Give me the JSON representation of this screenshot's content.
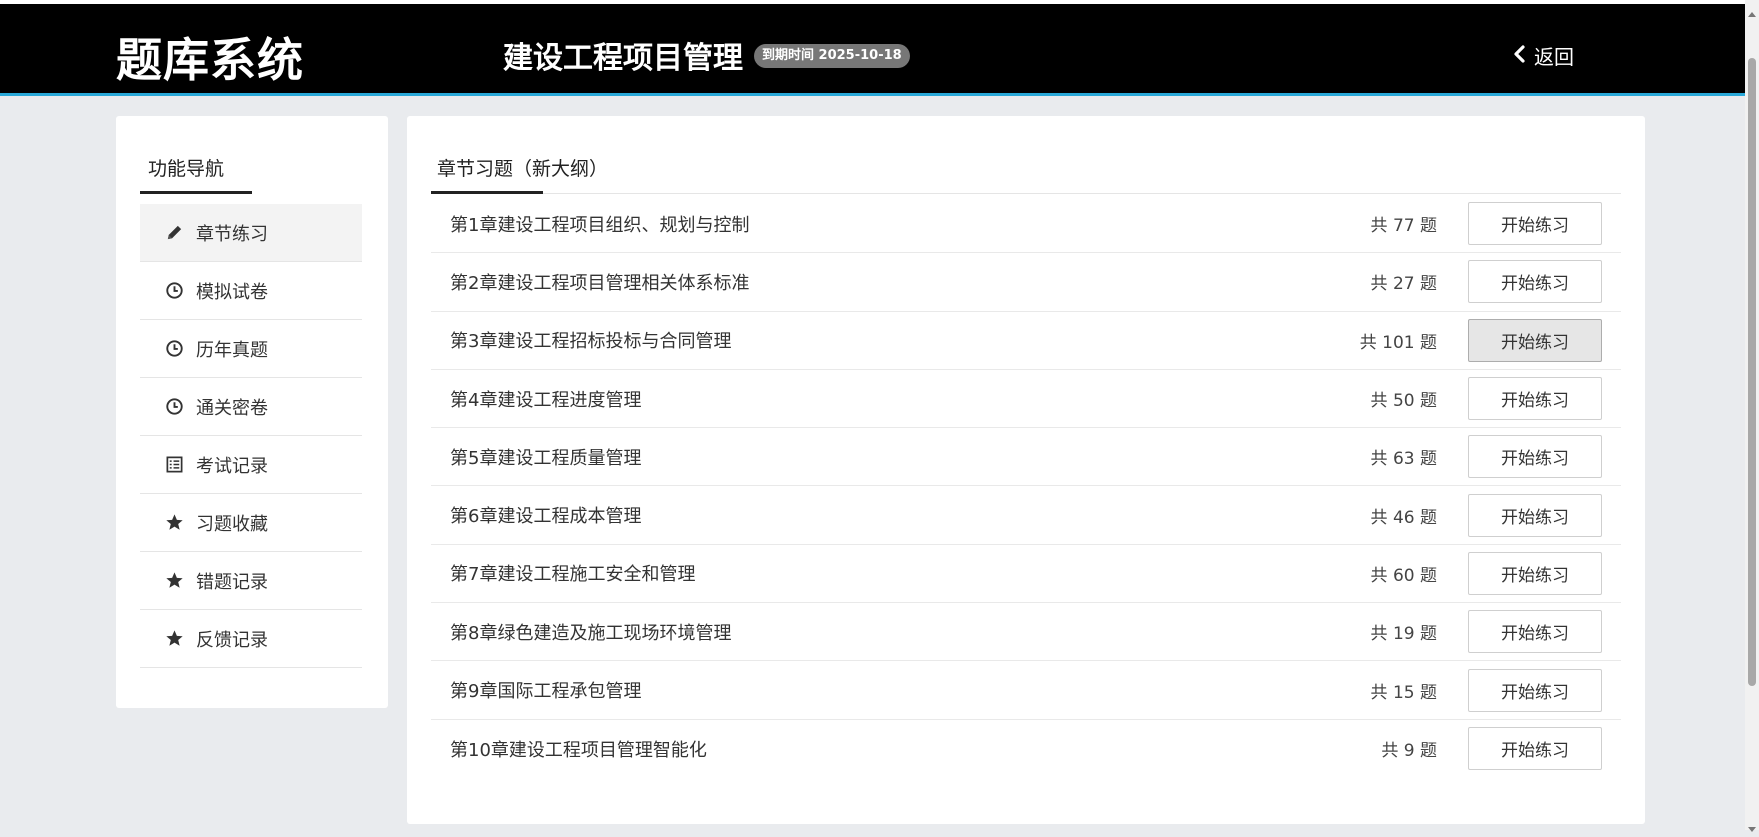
{
  "header": {
    "logo": "题库系统",
    "subject": "建设工程项目管理",
    "expire_badge": "到期时间 2025-10-18",
    "back_label": "返回"
  },
  "sidebar": {
    "title": "功能导航",
    "items": [
      {
        "label": "章节练习",
        "icon": "pencil-icon",
        "active": true
      },
      {
        "label": "模拟试卷",
        "icon": "clock-icon"
      },
      {
        "label": "历年真题",
        "icon": "clock-icon"
      },
      {
        "label": "通关密卷",
        "icon": "clock-icon"
      },
      {
        "label": "考试记录",
        "icon": "list-icon"
      },
      {
        "label": "习题收藏",
        "icon": "star-icon"
      },
      {
        "label": "错题记录",
        "icon": "star-icon"
      },
      {
        "label": "反馈记录",
        "icon": "star-icon"
      }
    ]
  },
  "main": {
    "tab": "章节习题（新大纲）",
    "chapters": [
      {
        "name": "第1章建设工程项目组织、规划与控制",
        "count": "共 77 题",
        "button": "开始练习"
      },
      {
        "name": "第2章建设工程项目管理相关体系标准",
        "count": "共 27 题",
        "button": "开始练习"
      },
      {
        "name": "第3章建设工程招标投标与合同管理",
        "count": "共 101 题",
        "button": "开始练习"
      },
      {
        "name": "第4章建设工程进度管理",
        "count": "共 50 题",
        "button": "开始练习"
      },
      {
        "name": "第5章建设工程质量管理",
        "count": "共 63 题",
        "button": "开始练习"
      },
      {
        "name": "第6章建设工程成本管理",
        "count": "共 46 题",
        "button": "开始练习"
      },
      {
        "name": "第7章建设工程施工安全和管理",
        "count": "共 60 题",
        "button": "开始练习"
      },
      {
        "name": "第8章绿色建造及施工现场环境管理",
        "count": "共 19 题",
        "button": "开始练习"
      },
      {
        "name": "第9章国际工程承包管理",
        "count": "共 15 题",
        "button": "开始练习"
      },
      {
        "name": "第10章建设工程项目管理智能化",
        "count": "共 9 题",
        "button": "开始练习"
      }
    ]
  },
  "colors": {
    "header_bg": "#000000",
    "header_accent": "#29a8d8",
    "page_bg": "#e9ebee"
  }
}
